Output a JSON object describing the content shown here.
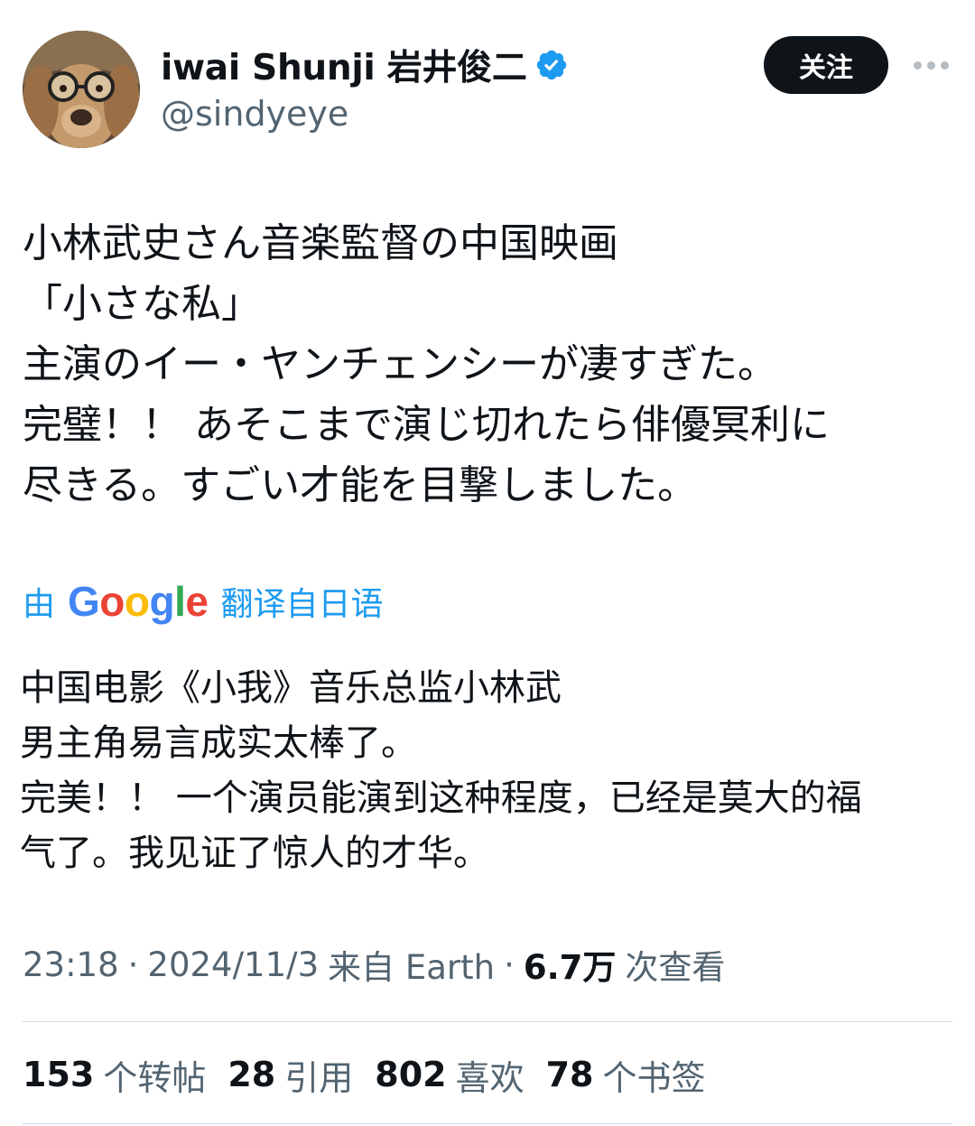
{
  "user": {
    "display_name": "iwai Shunji 岩井俊二",
    "handle": "@sindyeye",
    "verified": true,
    "avatar": "dog-with-glasses"
  },
  "actions": {
    "follow_label": "关注",
    "more_icon": "more-horizontal-icon"
  },
  "tweet": {
    "lines": [
      "小林武史さん音楽監督の中国映画",
      "「小さな私」",
      "主演のイー・ヤンチェンシーが凄すぎた。",
      "完璧！！ あそこまで演じ切れたら俳優冥利に",
      "尽きる。すごい才能を目撃しました。"
    ]
  },
  "translation": {
    "prefix": "由",
    "provider": "Google",
    "suffix": "翻译自日语",
    "lines": [
      "中国电影《小我》音乐总监小林武",
      "男主角易言成实太棒了。",
      "完美！！ 一个演员能演到这种程度，已经是莫大的福",
      "气了。我见证了惊人的才华。"
    ]
  },
  "meta": {
    "time": "23:18",
    "date": "2024/11/3",
    "source": "来自 Earth",
    "views_count": "6.7万",
    "views_label": "次查看",
    "separator": "·"
  },
  "stats": {
    "retweets": {
      "count": "153",
      "label": "个转帖"
    },
    "quotes": {
      "count": "28",
      "label": "引用"
    },
    "likes": {
      "count": "802",
      "label": "喜欢"
    },
    "bookmarks": {
      "count": "78",
      "label": "个书签"
    }
  },
  "colors": {
    "accent": "#1d9bf0",
    "text_primary": "#0f1419",
    "text_secondary": "#536471",
    "divider": "#cfd9de"
  }
}
